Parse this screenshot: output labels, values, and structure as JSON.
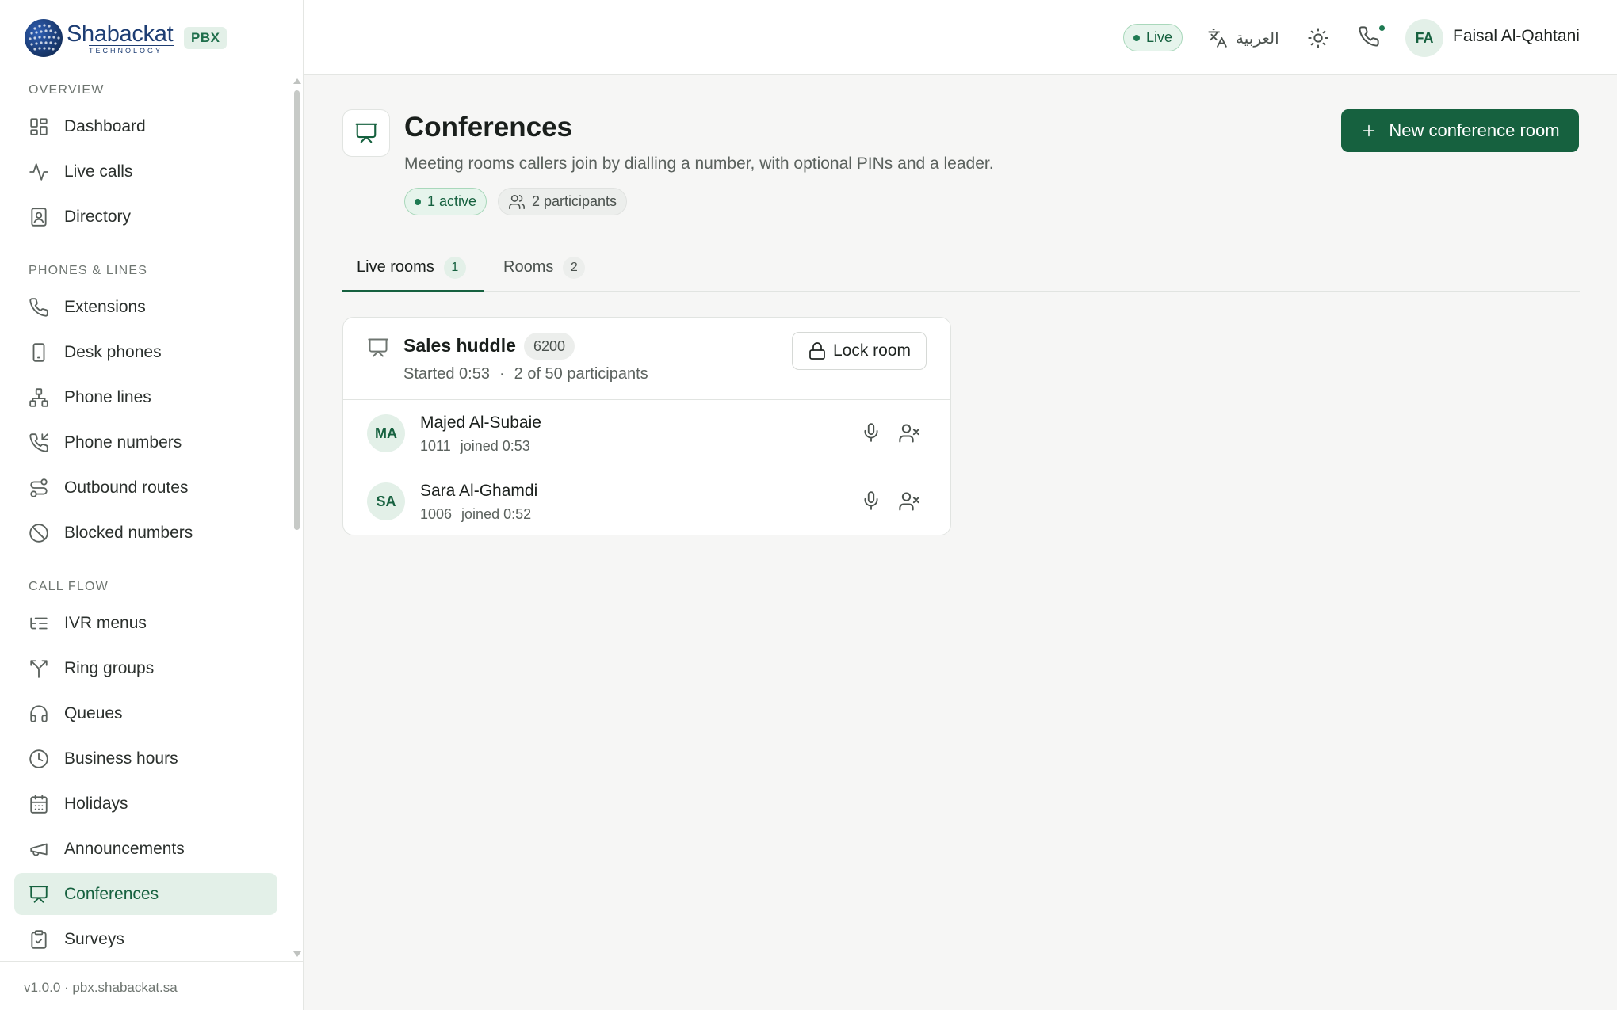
{
  "brand": {
    "name": "Shabackat",
    "sub": "TECHNOLOGY",
    "badge": "PBX",
    "brand_color": "#1d3d73"
  },
  "colors": {
    "accent": "#16613f",
    "accent_soft": "#e3f0e8",
    "live": "#1e7a52"
  },
  "sidebar": {
    "sections": [
      {
        "title": "OVERVIEW",
        "items": [
          {
            "label": "Dashboard",
            "icon": "dashboard-icon"
          },
          {
            "label": "Live calls",
            "icon": "activity-icon"
          },
          {
            "label": "Directory",
            "icon": "contact-book-icon"
          }
        ]
      },
      {
        "title": "PHONES & LINES",
        "items": [
          {
            "label": "Extensions",
            "icon": "phone-icon"
          },
          {
            "label": "Desk phones",
            "icon": "device-icon"
          },
          {
            "label": "Phone lines",
            "icon": "network-icon"
          },
          {
            "label": "Phone numbers",
            "icon": "phone-incoming-icon"
          },
          {
            "label": "Outbound routes",
            "icon": "route-icon"
          },
          {
            "label": "Blocked numbers",
            "icon": "ban-icon"
          }
        ]
      },
      {
        "title": "CALL FLOW",
        "items": [
          {
            "label": "IVR menus",
            "icon": "list-tree-icon"
          },
          {
            "label": "Ring groups",
            "icon": "split-icon"
          },
          {
            "label": "Queues",
            "icon": "headphones-icon"
          },
          {
            "label": "Business hours",
            "icon": "clock-icon"
          },
          {
            "label": "Holidays",
            "icon": "calendar-icon"
          },
          {
            "label": "Announcements",
            "icon": "megaphone-icon"
          },
          {
            "label": "Conferences",
            "icon": "presentation-icon",
            "active": true
          },
          {
            "label": "Surveys",
            "icon": "clipboard-check-icon"
          }
        ]
      }
    ],
    "footer": "v1.0.0 · pbx.shabackat.sa"
  },
  "topbar": {
    "live_label": "Live",
    "language_label": "العربية",
    "user": {
      "initials": "FA",
      "name": "Faisal Al-Qahtani"
    }
  },
  "page": {
    "title": "Conferences",
    "subtitle": "Meeting rooms callers join by dialling a number, with optional PINs and a leader.",
    "stats": {
      "active": "1 active",
      "participants": "2 participants"
    },
    "new_button": "New conference room"
  },
  "tabs": [
    {
      "label": "Live rooms",
      "count": "1",
      "active": true
    },
    {
      "label": "Rooms",
      "count": "2",
      "active": false
    }
  ],
  "room": {
    "name": "Sales huddle",
    "extension": "6200",
    "started": "Started 0:53",
    "separator": "·",
    "participants_summary": "2 of 50 participants",
    "lock_label": "Lock room",
    "participants": [
      {
        "initials": "MA",
        "name": "Majed Al-Subaie",
        "extension": "1011",
        "joined": "joined 0:53"
      },
      {
        "initials": "SA",
        "name": "Sara Al-Ghamdi",
        "extension": "1006",
        "joined": "joined 0:52"
      }
    ]
  }
}
